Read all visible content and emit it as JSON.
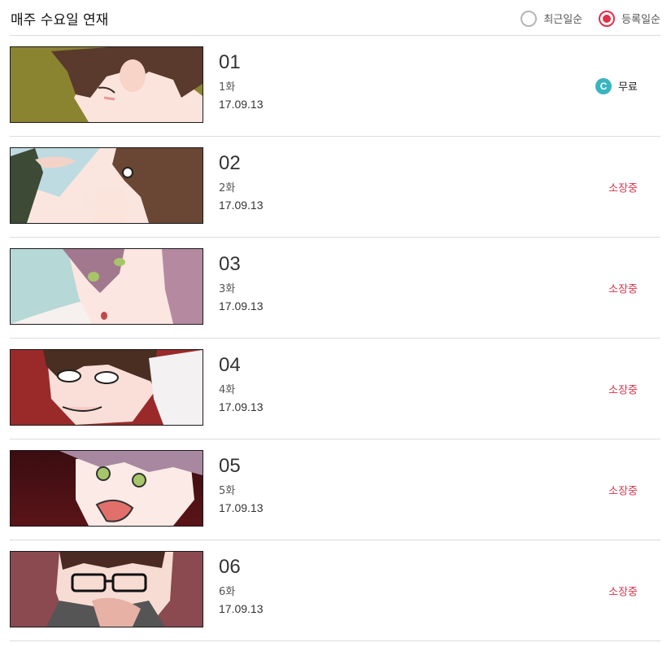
{
  "header": {
    "title": "매주 수요일 연재",
    "sort_options": [
      {
        "label": "최근일순",
        "selected": false
      },
      {
        "label": "등록일순",
        "selected": true
      }
    ]
  },
  "colors": {
    "accent": "#e0304a",
    "owned_status": "#d8334a",
    "free_coin": "#39b5c1",
    "divider": "#dcdcdc"
  },
  "episodes": [
    {
      "number": "01",
      "title": "1화",
      "date": "17.09.13",
      "status": "무료",
      "status_type": "free",
      "coin_label": "C"
    },
    {
      "number": "02",
      "title": "2화",
      "date": "17.09.13",
      "status": "소장중",
      "status_type": "owned"
    },
    {
      "number": "03",
      "title": "3화",
      "date": "17.09.13",
      "status": "소장중",
      "status_type": "owned"
    },
    {
      "number": "04",
      "title": "4화",
      "date": "17.09.13",
      "status": "소장중",
      "status_type": "owned"
    },
    {
      "number": "05",
      "title": "5화",
      "date": "17.09.13",
      "status": "소장중",
      "status_type": "owned"
    },
    {
      "number": "06",
      "title": "6화",
      "date": "17.09.13",
      "status": "소장중",
      "status_type": "owned"
    }
  ]
}
